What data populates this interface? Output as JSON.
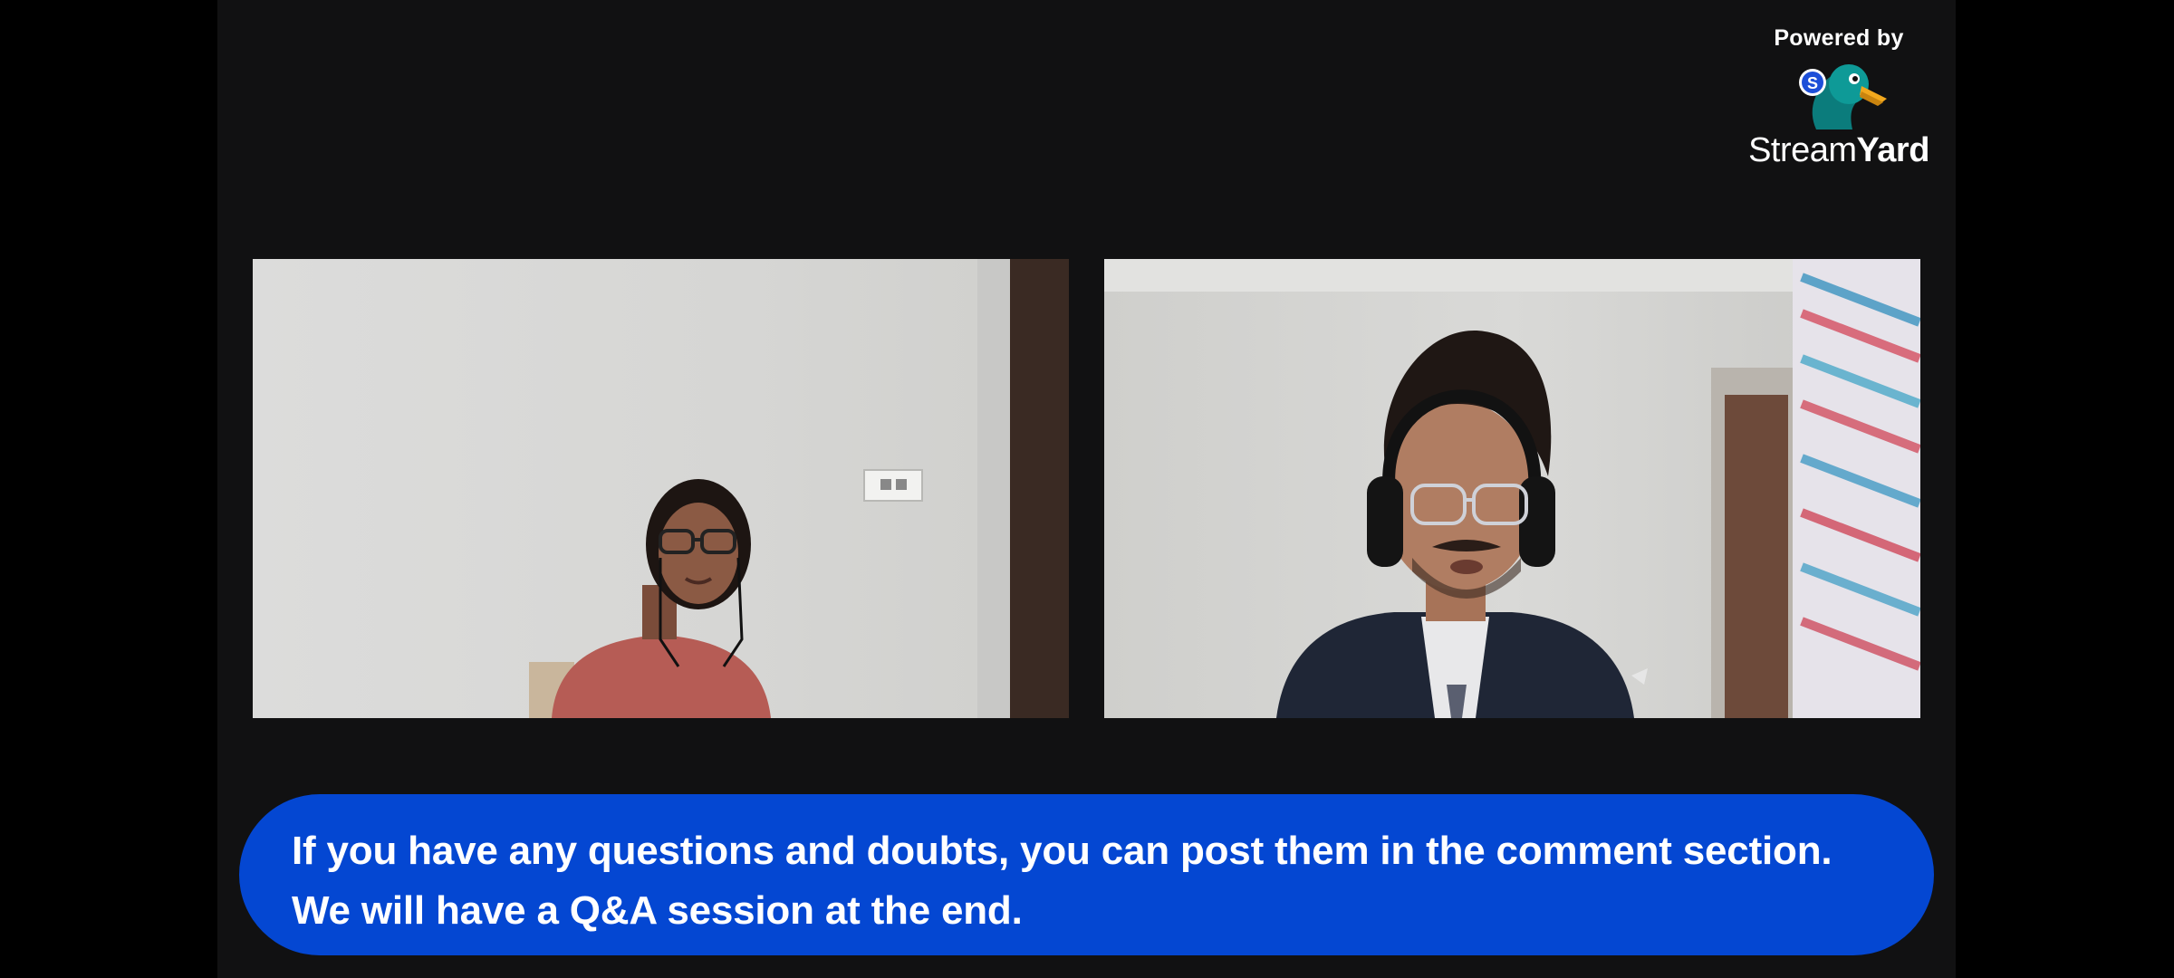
{
  "branding": {
    "powered_by": "Powered by",
    "name_regular": "Stream",
    "name_bold": "Yard",
    "logo_icon": "streamyard-duck-icon",
    "logo_badge_letter": "S"
  },
  "participants": [
    {
      "role": "guest",
      "description_icon": "participant-video-icon"
    },
    {
      "role": "host",
      "description_icon": "participant-video-icon"
    }
  ],
  "banner": {
    "text": "If you have any questions and doubts, you can post them in the comment section. We will have a Q&A session at the end."
  },
  "colors": {
    "stage_bg": "#111112",
    "banner_bg": "#0447d2",
    "logo_teal": "#0b8b8a",
    "logo_beak": "#f2a81d"
  }
}
